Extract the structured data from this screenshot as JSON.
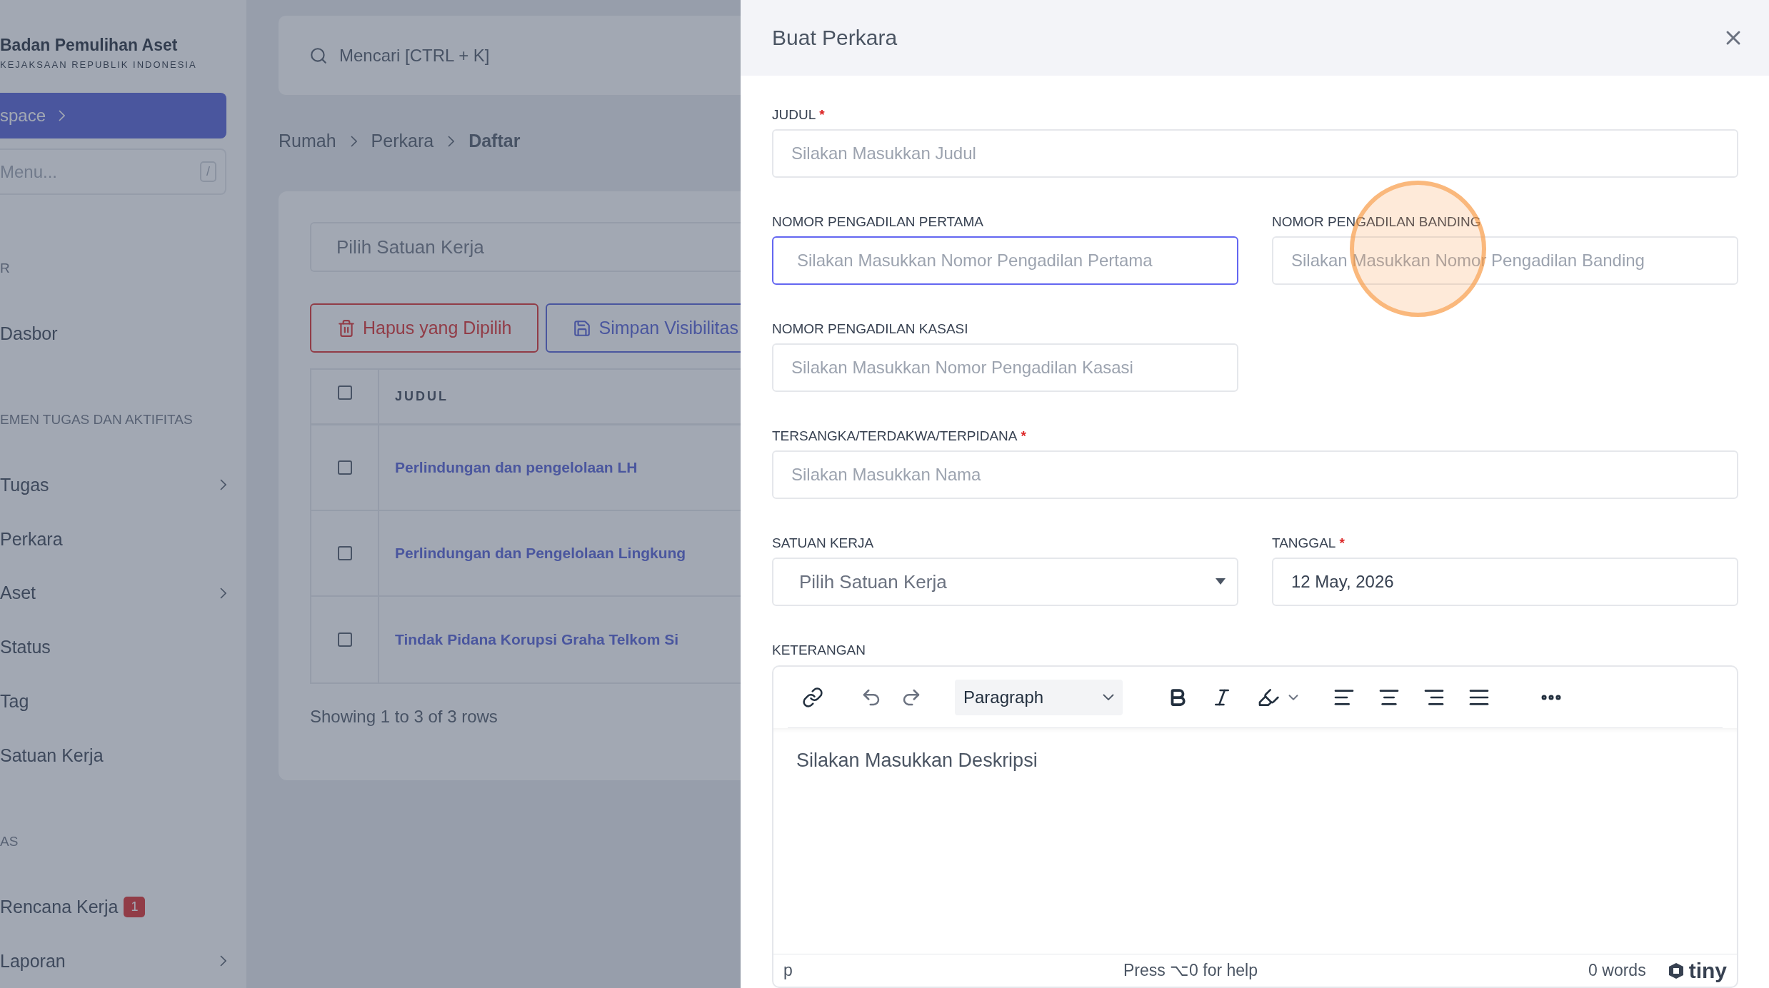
{
  "sidebar": {
    "brand": {
      "title": "Badan Pemulihan Aset",
      "subtitle": "KEJAKSAAN REPUBLIK INDONESIA"
    },
    "workspace_button": "space",
    "menu_search": {
      "placeholder": "Menu...",
      "shortcut": "/"
    },
    "sections": [
      {
        "heading": "R",
        "items": [
          {
            "label": "Dasbor",
            "expandable": false
          }
        ]
      },
      {
        "heading": "EMEN TUGAS DAN AKTIFITAS",
        "items": [
          {
            "label": "Tugas",
            "expandable": true
          },
          {
            "label": "Perkara",
            "expandable": false
          },
          {
            "label": "Aset",
            "expandable": true
          },
          {
            "label": "Status",
            "expandable": false
          },
          {
            "label": "Tag",
            "expandable": false
          },
          {
            "label": "Satuan Kerja",
            "expandable": false
          }
        ]
      },
      {
        "heading": "AS",
        "items": [
          {
            "label": "Rencana Kerja",
            "expandable": false,
            "badge": "1"
          },
          {
            "label": "Laporan",
            "expandable": true
          }
        ]
      }
    ]
  },
  "topbar": {
    "search": {
      "placeholder": "Mencari [CTRL + K]"
    }
  },
  "breadcrumb": [
    {
      "label": "Rumah",
      "current": false
    },
    {
      "label": "Perkara",
      "current": false
    },
    {
      "label": "Daftar",
      "current": true
    }
  ],
  "list_card": {
    "filter": {
      "placeholder": "Pilih Satuan Kerja"
    },
    "actions": [
      {
        "label": "Hapus yang Dipilih",
        "kind": "danger"
      },
      {
        "label": "Simpan Visibilitas",
        "kind": "primary"
      }
    ],
    "table": {
      "columns": [
        "JUDUL"
      ],
      "header_checked": false,
      "rows": [
        {
          "title": "Perlindungan dan pengelolaan LH",
          "checked": false
        },
        {
          "title": "Perlindungan dan Pengelolaan Lingkung",
          "checked": false
        },
        {
          "title": "Tindak Pidana Korupsi Graha Telkom Si",
          "checked": false
        }
      ]
    },
    "footer": "Showing 1 to 3 of 3 rows"
  },
  "drawer": {
    "title": "Buat Perkara",
    "fields": [
      {
        "label": "JUDUL",
        "required_mark": "*",
        "kind": "text",
        "full_width": true,
        "placeholder": "Silakan Masukkan Judul",
        "focused": false
      },
      {
        "label": "NOMOR PENGADILAN PERTAMA",
        "kind": "text",
        "full_width": false,
        "placeholder": "Silakan Masukkan Nomor Pengadilan Pertama",
        "focused": true
      },
      {
        "label": "NOMOR PENGADILAN BANDING",
        "kind": "text",
        "full_width": false,
        "placeholder": "Silakan Masukkan Nomor Pengadilan Banding",
        "focused": false
      },
      {
        "label": "NOMOR PENGADILAN KASASI",
        "kind": "text",
        "full_width": false,
        "placeholder": "Silakan Masukkan Nomor Pengadilan Kasasi",
        "focused": false
      },
      {
        "label": "TERSANGKA/TERDAKWA/TERPIDANA",
        "required_mark": "*",
        "kind": "text",
        "full_width": true,
        "placeholder": "Silakan Masukkan Nama",
        "focused": false
      },
      {
        "label": "SATUAN KERJA",
        "kind": "select",
        "full_width": false,
        "placeholder": "Pilih Satuan Kerja",
        "focused": false
      },
      {
        "label": "TANGGAL",
        "required_mark": "*",
        "kind": "date",
        "full_width": false,
        "value": "12 May, 2026",
        "focused": false
      }
    ],
    "editor": {
      "label": "KETERANGAN",
      "format": "Paragraph",
      "placeholder": "Silakan Masukkan Deskripsi",
      "path": "p",
      "help": "Press ⌥0 for help",
      "word_count": "0 words",
      "brand": "tiny"
    }
  }
}
